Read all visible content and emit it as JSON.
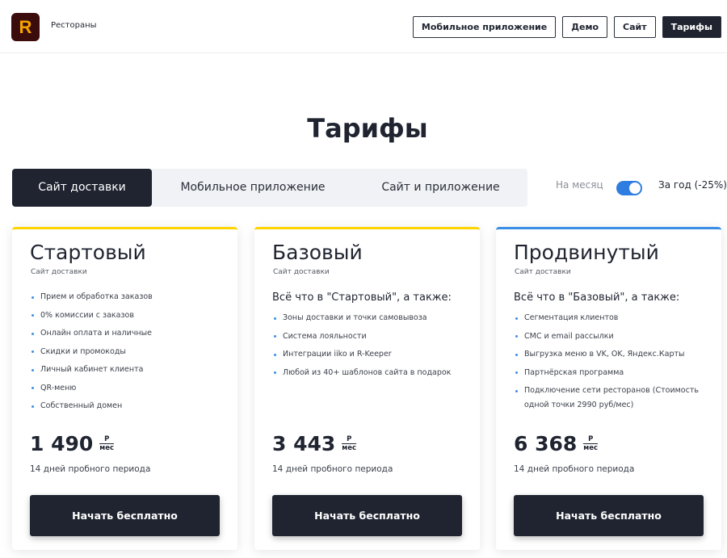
{
  "header": {
    "logo_letter": "R",
    "brand": "Рестораны",
    "nav": [
      "Мобильное приложение",
      "Демо",
      "Сайт",
      "Тарифы"
    ]
  },
  "page_title": "Тарифы",
  "tabs": [
    "Сайт доставки",
    "Мобильное приложение",
    "Сайт и приложение"
  ],
  "period": {
    "month": "На месяц",
    "year": "За год (-25%)",
    "year_selected": true
  },
  "plans": [
    {
      "name": "Стартовый",
      "subtitle": "Сайт доставки",
      "intro": "",
      "features": [
        "Прием и обработка заказов",
        "0% комиссии с заказов",
        "Онлайн оплата и наличные",
        "Скидки и промокоды",
        "Личный кабинет клиента",
        "QR-меню",
        "Собственный домен"
      ],
      "price": "1 490",
      "unit_top": "Р",
      "unit_bottom": "мес",
      "trial": "14 дней пробного периода",
      "cta": "Начать бесплатно"
    },
    {
      "name": "Базовый",
      "subtitle": "Сайт доставки",
      "intro": "Всё что в \"Стартовый\", а также:",
      "features": [
        "Зоны доставки и точки самовывоза",
        "Система лояльности",
        "Интеграции iiko и R-Keeper",
        "Любой из 40+ шаблонов сайта в подарок"
      ],
      "price": "3 443",
      "unit_top": "Р",
      "unit_bottom": "мес",
      "trial": "14 дней пробного периода",
      "cta": "Начать бесплатно"
    },
    {
      "name": "Продвинутый",
      "subtitle": "Сайт доставки",
      "intro": "Всё что в \"Базовый\", а также:",
      "features": [
        "Сегментация клиентов",
        "СМС и email рассылки",
        "Выгрузка меню в VK, OK, Яндекс.Карты",
        "Партнёрская программа",
        "Подключение сети ресторанов (Стоимость одной точки 2990 руб/мес)"
      ],
      "price": "6 368",
      "unit_top": "Р",
      "unit_bottom": "мес",
      "trial": "14 дней пробного периода",
      "cta": "Начать бесплатно"
    }
  ],
  "colors": {
    "dark": "#1f2430",
    "accent_yellow": "#ffd400",
    "accent_blue": "#3a8ee6",
    "toggle": "#2f7de1"
  }
}
